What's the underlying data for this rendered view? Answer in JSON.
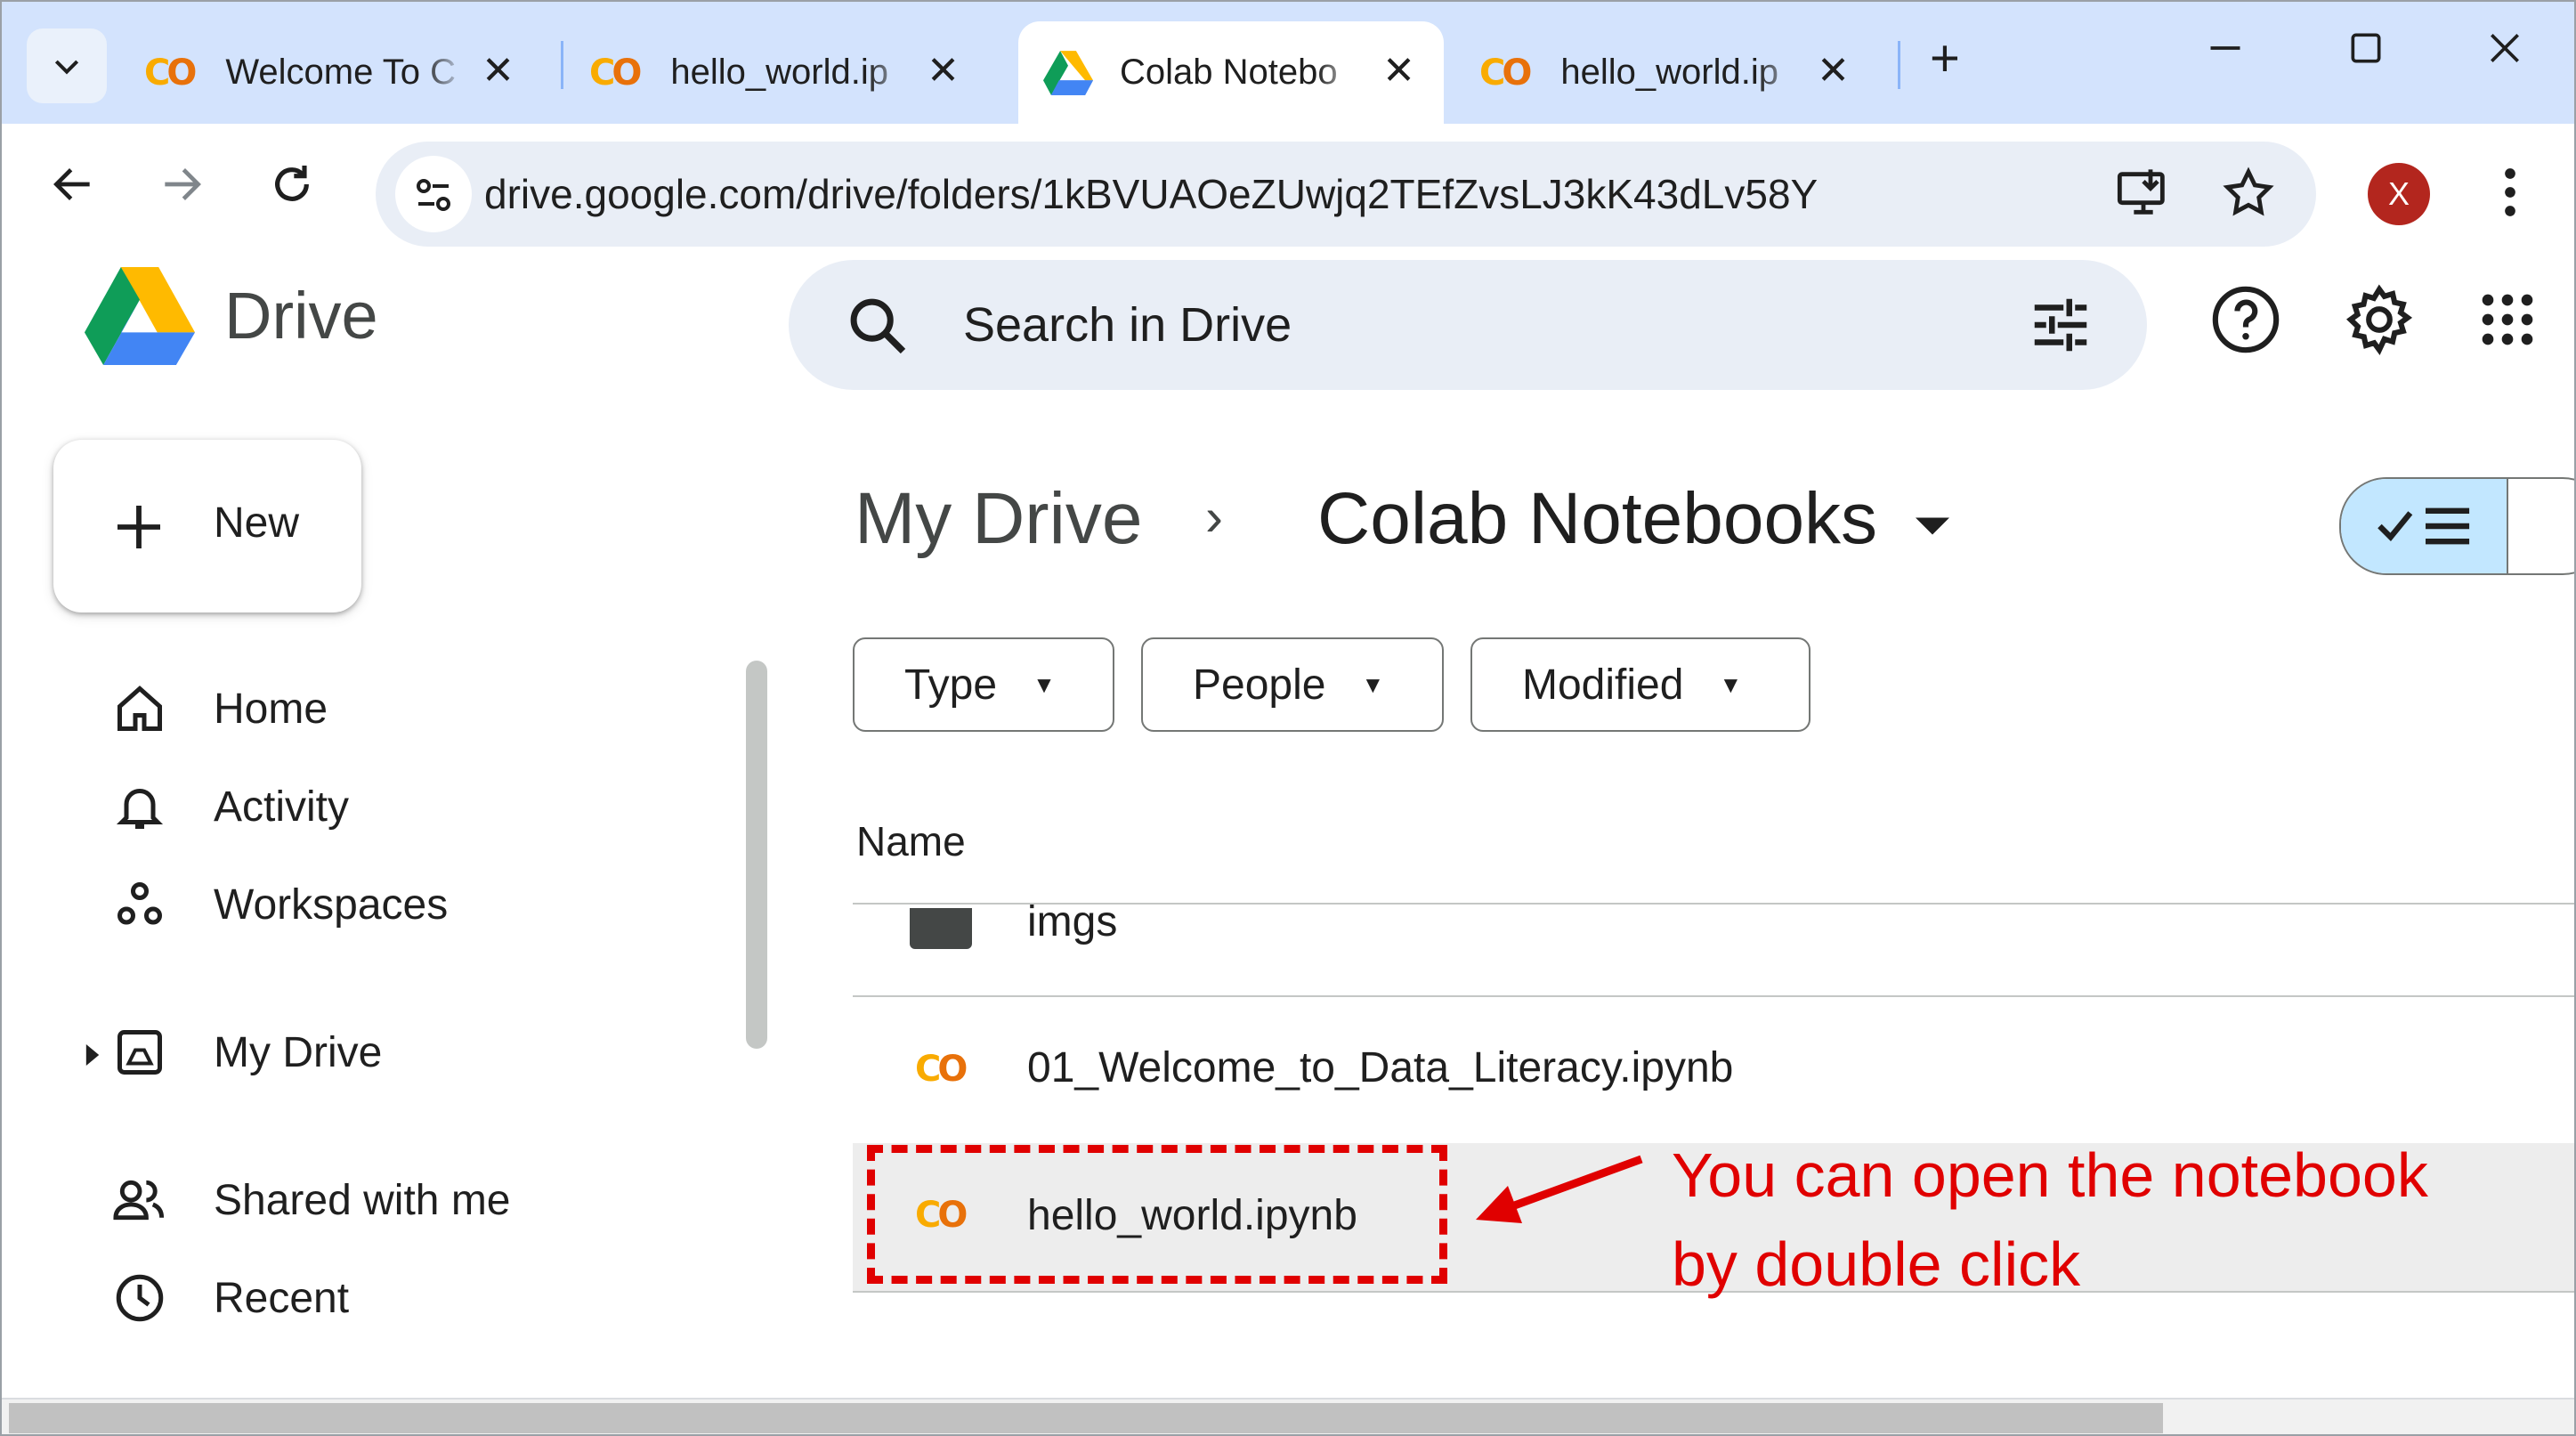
{
  "browser": {
    "tabs": [
      {
        "title": "Welcome To C",
        "icon": "colab-icon",
        "active": false
      },
      {
        "title": "hello_world.ip",
        "icon": "colab-icon",
        "active": false
      },
      {
        "title": "Colab Notebo",
        "icon": "google-drive-icon",
        "active": true
      },
      {
        "title": "hello_world.ip",
        "icon": "colab-icon",
        "active": false
      }
    ],
    "new_tab": "+",
    "url": "drive.google.com/drive/folders/1kBVUAOeZUwjq2TEfZvsLJ3kK43dLv58Y",
    "profile_initial": "X"
  },
  "drive": {
    "app_name": "Drive",
    "search_placeholder": "Search in Drive",
    "new_button": "New",
    "nav": [
      {
        "label": "Home",
        "icon": "home-icon"
      },
      {
        "label": "Activity",
        "icon": "bell-icon"
      },
      {
        "label": "Workspaces",
        "icon": "workspaces-icon"
      },
      {
        "label": "My Drive",
        "icon": "my-drive-icon"
      },
      {
        "label": "Shared with me",
        "icon": "people-icon"
      },
      {
        "label": "Recent",
        "icon": "clock-icon"
      }
    ],
    "breadcrumb": {
      "root": "My Drive",
      "separator": "›",
      "current": "Colab Notebooks"
    },
    "filters": [
      "Type",
      "People",
      "Modified"
    ],
    "column_header": "Name",
    "files": [
      {
        "name": "imgs",
        "type": "folder"
      },
      {
        "name": "01_Welcome_to_Data_Literacy.ipynb",
        "type": "colab"
      },
      {
        "name": "hello_world.ipynb",
        "type": "colab"
      }
    ]
  },
  "annotation": {
    "line1": "You can open the notebook",
    "line2": "by double click",
    "color": "#e00000"
  }
}
